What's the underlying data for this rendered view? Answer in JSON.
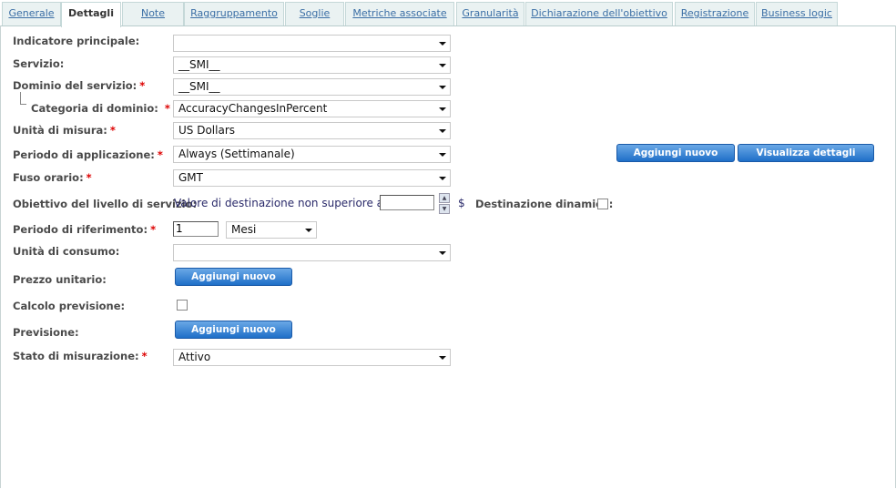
{
  "tabs": [
    {
      "label": "Generale"
    },
    {
      "label": "Dettagli"
    },
    {
      "label": "Note"
    },
    {
      "label": "Raggruppamento"
    },
    {
      "label": "Soglie"
    },
    {
      "label": "Metriche associate"
    },
    {
      "label": "Granularità"
    },
    {
      "label": "Dichiarazione dell'obiettivo"
    },
    {
      "label": "Registrazione"
    },
    {
      "label": "Business logic"
    }
  ],
  "form": {
    "indicatore": {
      "label": "Indicatore principale:",
      "value": ""
    },
    "servizio": {
      "label": "Servizio:",
      "value": "__SMI__"
    },
    "dominio": {
      "label": "Dominio del servizio:",
      "value": "__SMI__"
    },
    "categoria": {
      "label": "Categoria di dominio:",
      "value": "AccuracyChangesInPercent"
    },
    "unita": {
      "label": "Unità di misura:",
      "value": "US Dollars"
    },
    "periodo_app": {
      "label": "Periodo di applicazione:",
      "value": "Always (Settimanale)",
      "add": "Aggiungi nuovo",
      "details": "Visualizza dettagli"
    },
    "fuso": {
      "label": "Fuso orario:",
      "value": "GMT"
    },
    "obiettivo": {
      "label": "Obiettivo del livello di servizio:",
      "text": "Valore di destinazione non superiore a",
      "value": "",
      "currency": "$",
      "dynamic_label": "Destinazione dinamica:"
    },
    "periodo_rif": {
      "label": "Periodo di riferimento:",
      "value": "1",
      "unit": "Mesi"
    },
    "consumo": {
      "label": "Unità di consumo:",
      "value": ""
    },
    "prezzo": {
      "label": "Prezzo unitario:",
      "add": "Aggiungi nuovo"
    },
    "calcolo": {
      "label": "Calcolo previsione:"
    },
    "previsione": {
      "label": "Previsione:",
      "add": "Aggiungi nuovo"
    },
    "stato": {
      "label": "Stato di misurazione:",
      "value": "Attivo"
    },
    "required_mark": "*"
  }
}
